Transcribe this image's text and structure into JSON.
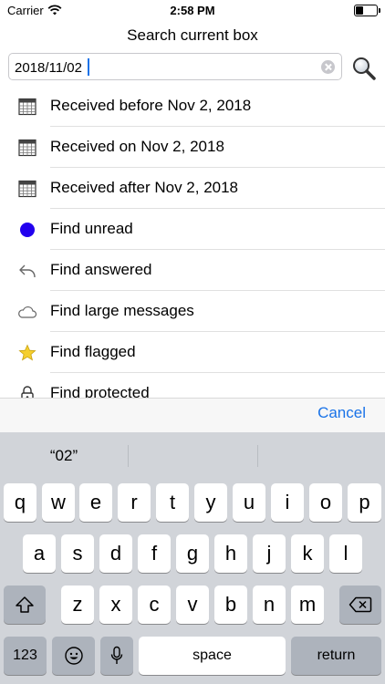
{
  "status_bar": {
    "carrier": "Carrier",
    "time": "2:58 PM"
  },
  "nav": {
    "title": "Search current box"
  },
  "search": {
    "value": "2018/11/02",
    "placeholder": ""
  },
  "list_items": [
    {
      "icon": "calendar-icon",
      "label": "Received before Nov 2, 2018"
    },
    {
      "icon": "calendar-icon",
      "label": "Received on Nov 2, 2018"
    },
    {
      "icon": "calendar-icon",
      "label": "Received after Nov 2, 2018"
    },
    {
      "icon": "blue-dot-icon",
      "label": "Find unread"
    },
    {
      "icon": "reply-arrow-icon",
      "label": "Find answered"
    },
    {
      "icon": "cloud-icon",
      "label": "Find large messages"
    },
    {
      "icon": "star-icon",
      "label": "Find flagged"
    },
    {
      "icon": "lock-icon",
      "label": "Find protected"
    }
  ],
  "cancel_label": "Cancel",
  "keyboard": {
    "suggestions": [
      "“02”",
      "",
      ""
    ],
    "row1": [
      "q",
      "w",
      "e",
      "r",
      "t",
      "y",
      "u",
      "i",
      "o",
      "p"
    ],
    "row2": [
      "a",
      "s",
      "d",
      "f",
      "g",
      "h",
      "j",
      "k",
      "l"
    ],
    "row3": [
      "z",
      "x",
      "c",
      "v",
      "b",
      "n",
      "m"
    ],
    "numbers_label": "123",
    "space_label": "space",
    "return_label": "return"
  },
  "colors": {
    "accent": "#1a73e8",
    "unread_dot": "#2200ee",
    "star": "#f5cf2e"
  }
}
